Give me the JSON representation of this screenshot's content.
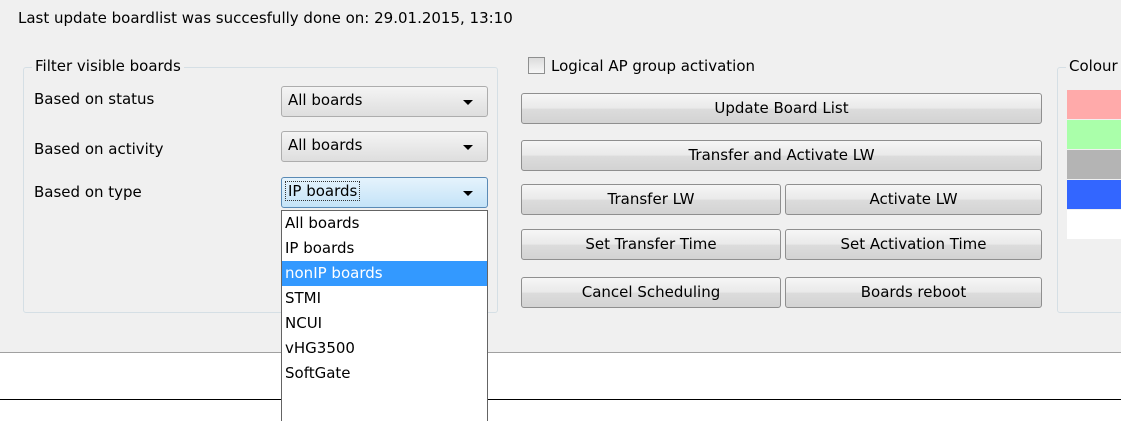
{
  "status_line": "Last update boardlist was succesfully done on: 29.01.2015, 13:10",
  "filter_group": {
    "legend": "Filter visible boards",
    "rows": [
      {
        "label": "Based on status",
        "value": "All boards"
      },
      {
        "label": "Based on activity",
        "value": "All boards"
      },
      {
        "label": "Based on type",
        "value": "IP boards"
      }
    ]
  },
  "type_dropdown": {
    "options": [
      "All boards",
      "IP boards",
      "nonIP boards",
      "STMI",
      "NCUI",
      "vHG3500",
      "SoftGate"
    ],
    "highlighted": "nonIP boards"
  },
  "checkbox": {
    "label": "Logical AP group activation",
    "checked": false
  },
  "buttons": {
    "update_board_list": "Update Board List",
    "transfer_and_activate": "Transfer and Activate LW",
    "transfer_lw": "Transfer LW",
    "activate_lw": "Activate LW",
    "set_transfer_time": "Set Transfer Time",
    "set_activation_time": "Set Activation Time",
    "cancel_scheduling": "Cancel Scheduling",
    "boards_reboot": "Boards reboot"
  },
  "colour_group": {
    "legend": "Colour",
    "swatches": [
      "#ffaaaa",
      "#aaffaa",
      "#b4b4b4",
      "#3366ff",
      "#ffffff"
    ]
  }
}
